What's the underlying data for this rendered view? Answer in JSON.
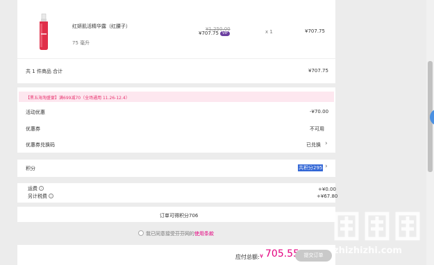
{
  "product": {
    "name": "红妍肌活精华露（红腰子）",
    "spec": "75 毫升",
    "original_price": "¥1,250.00",
    "price": "¥707.75",
    "vip_badge": "VIP",
    "quantity": "x 1",
    "subtotal": "¥707.75"
  },
  "summary": {
    "label": "共 1 件商品 合计",
    "amount": "¥707.75"
  },
  "discounts": {
    "promo_text": "【黑五海淘盛宴】满699减70（全场通用 11.26-12.4）",
    "rows": [
      {
        "label": "活动优惠",
        "value": "-¥70.00"
      },
      {
        "label": "优惠券",
        "value": "不可用"
      },
      {
        "label": "优惠券兑换码",
        "value": "已兑换"
      }
    ]
  },
  "points": {
    "label": "积分",
    "value": "共积分295"
  },
  "fees": {
    "shipping_label": "运费",
    "shipping_value": "+¥0.00",
    "tax_label": "另计税费",
    "tax_value": "+¥67.80"
  },
  "earn": {
    "text": "订单可得积分706"
  },
  "agreement": {
    "prefix": "我已同意接受芬芬网的",
    "link": "使用条款"
  },
  "footer": {
    "total_label": "应付总额:",
    "currency": "¥",
    "total": "705.55",
    "submit_label": "提交订单"
  },
  "watermark": {
    "text": "zhizhizhi.com"
  },
  "colors": {
    "accent_pink": "#e3007f",
    "promo_bg": "#fde7ef",
    "vip_purple": "#6b3fa0",
    "selection_blue": "#3367d6"
  }
}
